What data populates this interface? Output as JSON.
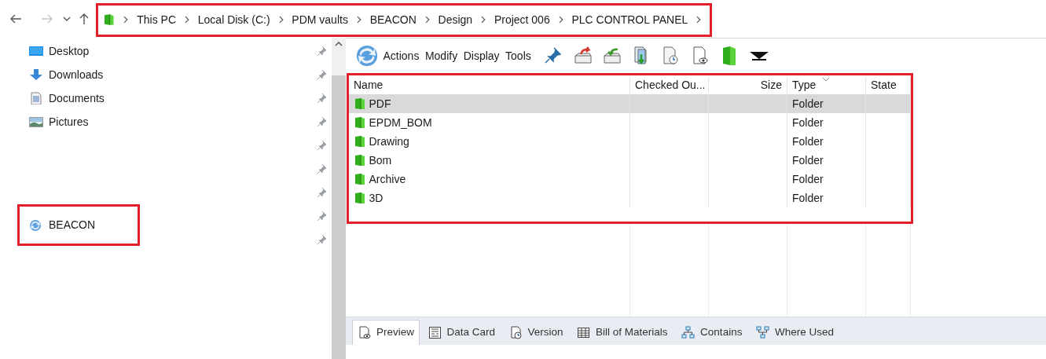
{
  "breadcrumb": {
    "highlighted": true,
    "segments": [
      "This PC",
      "Local Disk (C:)",
      "PDM vaults",
      "BEACON",
      "Design",
      "Project 006",
      "PLC CONTROL PANEL"
    ]
  },
  "sidebar": {
    "items": [
      {
        "kind": "desktop",
        "label": "Desktop",
        "pinned": true,
        "highlighted": false
      },
      {
        "kind": "downloads",
        "label": "Downloads",
        "pinned": true,
        "highlighted": false
      },
      {
        "kind": "documents",
        "label": "Documents",
        "pinned": true,
        "highlighted": false
      },
      {
        "kind": "pictures",
        "label": "Pictures",
        "pinned": true,
        "highlighted": false
      },
      {
        "kind": "blank",
        "pinned": true,
        "highlighted": false
      },
      {
        "kind": "blank",
        "pinned": true,
        "highlighted": false
      },
      {
        "kind": "blank",
        "pinned": true,
        "highlighted": false
      },
      {
        "kind": "vault",
        "label": "BEACON",
        "pinned": true,
        "highlighted": true
      },
      {
        "kind": "blank",
        "pinned": true,
        "highlighted": false
      }
    ]
  },
  "menus": [
    "Actions",
    "Modify",
    "Display",
    "Tools"
  ],
  "table": {
    "highlighted": true,
    "columns": [
      {
        "label": "Name",
        "sorted": false
      },
      {
        "label": "Checked Ou...",
        "sorted": false
      },
      {
        "label": "Size",
        "sorted": false
      },
      {
        "label": "Type",
        "sorted": true
      },
      {
        "label": "State",
        "sorted": false
      }
    ],
    "rows": [
      {
        "name": "PDF",
        "type": "Folder",
        "selected": true
      },
      {
        "name": "EPDM_BOM",
        "type": "Folder",
        "selected": false
      },
      {
        "name": "Drawing",
        "type": "Folder",
        "selected": false
      },
      {
        "name": "Bom",
        "type": "Folder",
        "selected": false
      },
      {
        "name": "Archive",
        "type": "Folder",
        "selected": false
      },
      {
        "name": "3D",
        "type": "Folder",
        "selected": false
      }
    ]
  },
  "bottom_tabs": [
    {
      "label": "Preview",
      "selected": true
    },
    {
      "label": "Data Card",
      "selected": false
    },
    {
      "label": "Version",
      "selected": false
    },
    {
      "label": "Bill of Materials",
      "selected": false
    },
    {
      "label": "Contains",
      "selected": false
    },
    {
      "label": "Where Used",
      "selected": false
    }
  ]
}
